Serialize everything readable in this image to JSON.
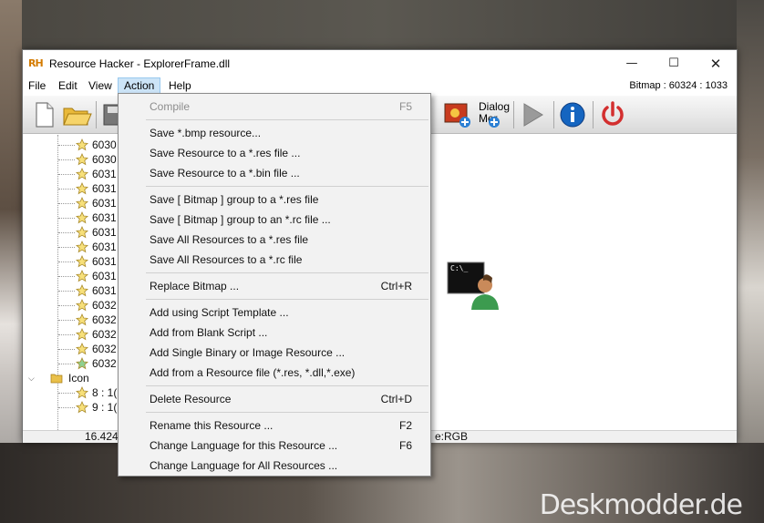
{
  "window": {
    "app_icon_text": "RH",
    "title": "Resource Hacker - ExplorerFrame.dll",
    "controls": {
      "minimize": "—",
      "maximize": "☐",
      "close": "✕"
    }
  },
  "menubar": {
    "items": [
      "File",
      "Edit",
      "View",
      "Action",
      "Help"
    ],
    "status": "Bitmap : 60324 : 1033"
  },
  "toolbar": {
    "buttons": [
      "new-file",
      "open-folder",
      "save",
      "add-image",
      "dialog-menu",
      "run-script",
      "info",
      "power"
    ],
    "dialog_label_line1": "Dialog",
    "dialog_label_line2": "Mer"
  },
  "tree": {
    "items": [
      {
        "label": "6030"
      },
      {
        "label": "6030"
      },
      {
        "label": "6031"
      },
      {
        "label": "6031"
      },
      {
        "label": "6031"
      },
      {
        "label": "6031"
      },
      {
        "label": "6031"
      },
      {
        "label": "6031"
      },
      {
        "label": "6031"
      },
      {
        "label": "6031"
      },
      {
        "label": "6031"
      },
      {
        "label": "6032"
      },
      {
        "label": "6032"
      },
      {
        "label": "6032"
      },
      {
        "label": "6032"
      },
      {
        "label": "6032"
      }
    ],
    "group_label": "Icon",
    "group_children": [
      {
        "label": "8 : 1("
      },
      {
        "label": "9 : 1("
      }
    ]
  },
  "statusbar": {
    "left": "16.424",
    "right": "e:RGB"
  },
  "action_menu": {
    "items": [
      {
        "label": "Compile",
        "shortcut": "F5",
        "disabled": true
      },
      {
        "label": "Save *.bmp resource...",
        "shortcut": ""
      },
      {
        "label": "Save Resource to a *.res file ...",
        "shortcut": ""
      },
      {
        "label": "Save Resource to a *.bin file ...",
        "shortcut": ""
      },
      {
        "label": "Save [ Bitmap ] group to a *.res file",
        "shortcut": ""
      },
      {
        "label": "Save [ Bitmap ] group to an *.rc file ...",
        "shortcut": ""
      },
      {
        "label": "Save All Resources to a *.res file",
        "shortcut": ""
      },
      {
        "label": "Save All Resources to a *.rc file",
        "shortcut": ""
      },
      {
        "label": "Replace Bitmap ...",
        "shortcut": "Ctrl+R"
      },
      {
        "label": "Add using Script Template ...",
        "shortcut": ""
      },
      {
        "label": "Add from Blank Script ...",
        "shortcut": ""
      },
      {
        "label": "Add Single Binary or Image Resource ...",
        "shortcut": ""
      },
      {
        "label": "Add from a Resource file (*.res, *.dll,*.exe)",
        "shortcut": ""
      },
      {
        "label": "Delete Resource",
        "shortcut": "Ctrl+D"
      },
      {
        "label": "Rename this Resource ...",
        "shortcut": "F2"
      },
      {
        "label": "Change Language for this Resource ...",
        "shortcut": "F6"
      },
      {
        "label": "Change Language for All Resources ...",
        "shortcut": ""
      }
    ]
  },
  "preview": {
    "console_text": "C:\\_"
  },
  "watermark": "Deskmodder.de"
}
